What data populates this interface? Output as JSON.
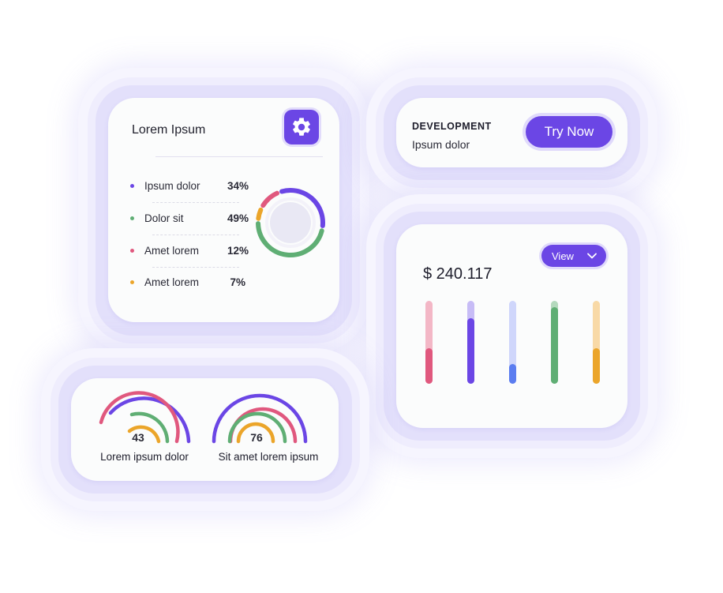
{
  "stats_card": {
    "title": "Lorem Ipsum",
    "settings_icon": "gear-icon",
    "items": [
      {
        "label": "Ipsum dolor",
        "percent": "34%",
        "color": "#6b46e5"
      },
      {
        "label": "Dolor sit",
        "percent": "49%",
        "color": "#5fae74"
      },
      {
        "label": "Amet lorem",
        "percent": "12%",
        "color": "#e0587e"
      },
      {
        "label": "Amet lorem",
        "percent": "7%",
        "color": "#eba52a"
      }
    ]
  },
  "promo_card": {
    "title": "DEVELOPMENT",
    "subtitle": "Ipsum dolor",
    "button_label": "Try Now"
  },
  "balance_card": {
    "view_label": "View",
    "amount": "$ 240.117",
    "bars": [
      {
        "color": "#e0587e",
        "track": "#f3b7c6",
        "level": 0.43
      },
      {
        "color": "#6b46e5",
        "track": "#c7bcf6",
        "level": 0.79
      },
      {
        "color": "#5b7df0",
        "track": "#cfd6fb",
        "level": 0.24
      },
      {
        "color": "#5fae74",
        "track": "#b4d9bd",
        "level": 0.92
      },
      {
        "color": "#eba52a",
        "track": "#f8d9a6",
        "level": 0.43
      }
    ]
  },
  "gauges_card": {
    "gauges": [
      {
        "value": "43",
        "label": "Lorem ipsum dolor"
      },
      {
        "value": "76",
        "label": "Sit amet lorem ipsum"
      }
    ]
  }
}
